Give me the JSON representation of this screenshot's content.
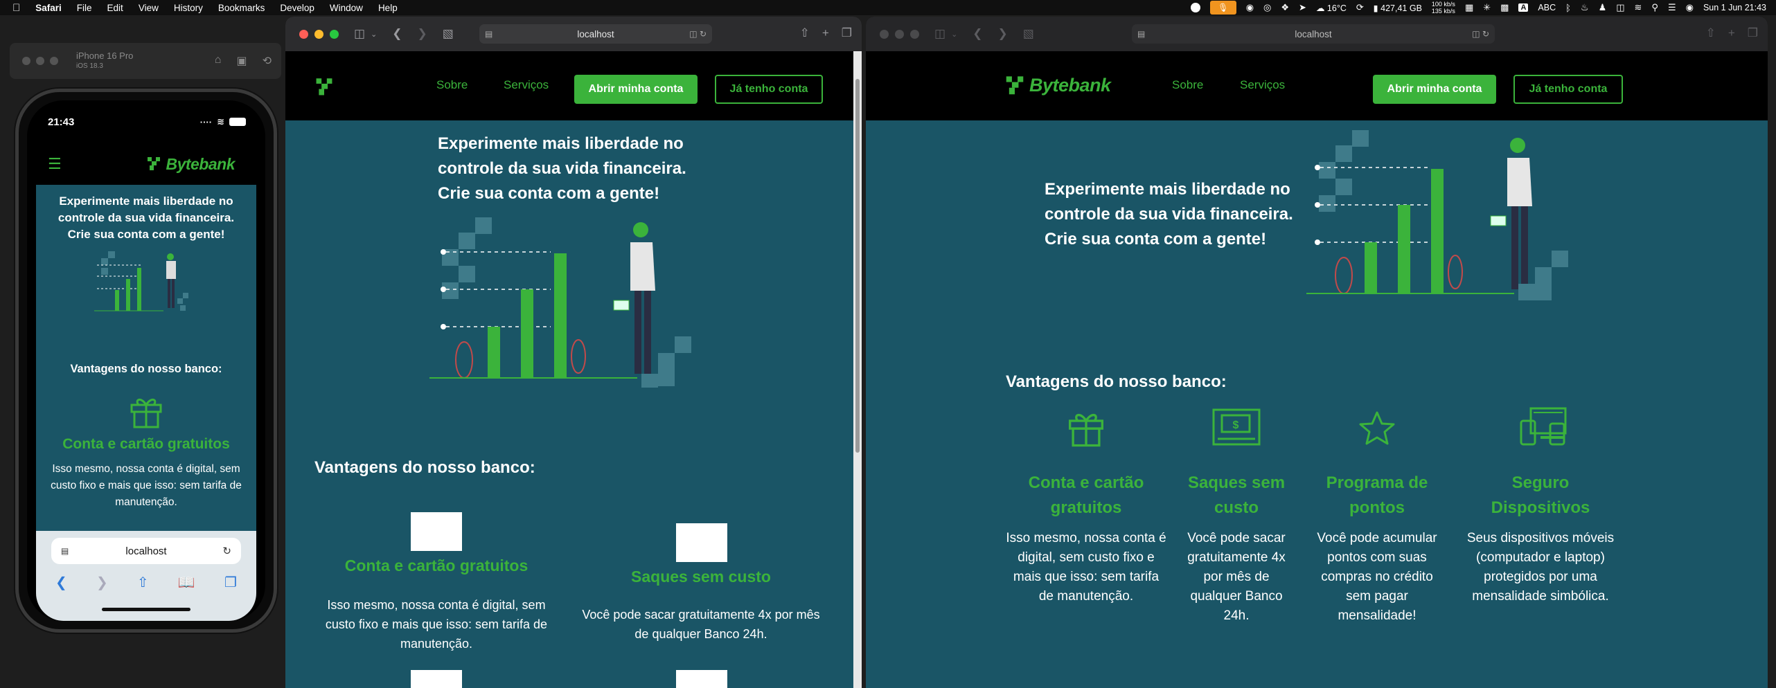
{
  "menubar": {
    "app": "Safari",
    "menus": [
      "File",
      "Edit",
      "View",
      "History",
      "Bookmarks",
      "Develop",
      "Window",
      "Help"
    ],
    "temperature": "16°C",
    "disk": "427,41 GB",
    "net_up": "100 kb/s",
    "net_down": "135 kb/s",
    "input_source": "ABC",
    "datetime": "Sun 1 Jun  21:43"
  },
  "simulator": {
    "device": "iPhone 16 Pro",
    "os": "iOS 18.3",
    "time": "21:43",
    "url": "localhost"
  },
  "site": {
    "logo": "Bytebank",
    "nav": {
      "sobre": "Sobre",
      "servicos": "Serviços",
      "abrir": "Abrir minha conta",
      "tenho": "Já tenho conta"
    },
    "hero": {
      "line1": "Experimente mais liberdade no",
      "line2": "controle da sua vida financeira.",
      "line3": "Crie sua conta com a gente!",
      "mobile_line1": "Experimente mais liberdade no",
      "mobile_line2": "controle da sua vida financeira.",
      "mobile_line3": "Crie sua conta com a gente!"
    },
    "advantages_title": "Vantagens do nosso banco:",
    "features": [
      {
        "title": "Conta e cartão gratuitos",
        "title_l1": "Conta e cartão",
        "title_l2": "gratuitos",
        "desc": "Isso mesmo, nossa conta é digital, sem custo fixo e mais que isso: sem tarifa de manutenção.",
        "icon": "gift-icon"
      },
      {
        "title": "Saques sem custo",
        "title_l1": "Saques sem",
        "title_l2": "custo",
        "desc": "Você pode sacar gratuitamente 4x por mês de qualquer Banco 24h.",
        "icon": "cash-withdrawal-icon"
      },
      {
        "title": "Programa de pontos",
        "title_l1": "Programa de",
        "title_l2": "pontos",
        "desc": "Você pode acumular pontos com suas compras no crédito sem pagar mensalidade!",
        "icon": "star-icon"
      },
      {
        "title": "Seguro Dispositivos",
        "title_l1": "Seguro",
        "title_l2": "Dispositivos",
        "desc": "Seus dispositivos móveis (computador e laptop) protegidos por uma mensalidade simbólica.",
        "icon": "devices-icon"
      }
    ]
  },
  "browser": {
    "url": "localhost"
  },
  "colors": {
    "brand_green": "#3bb33b",
    "teal_bg": "#1a5566",
    "nav_bg": "#000000"
  }
}
